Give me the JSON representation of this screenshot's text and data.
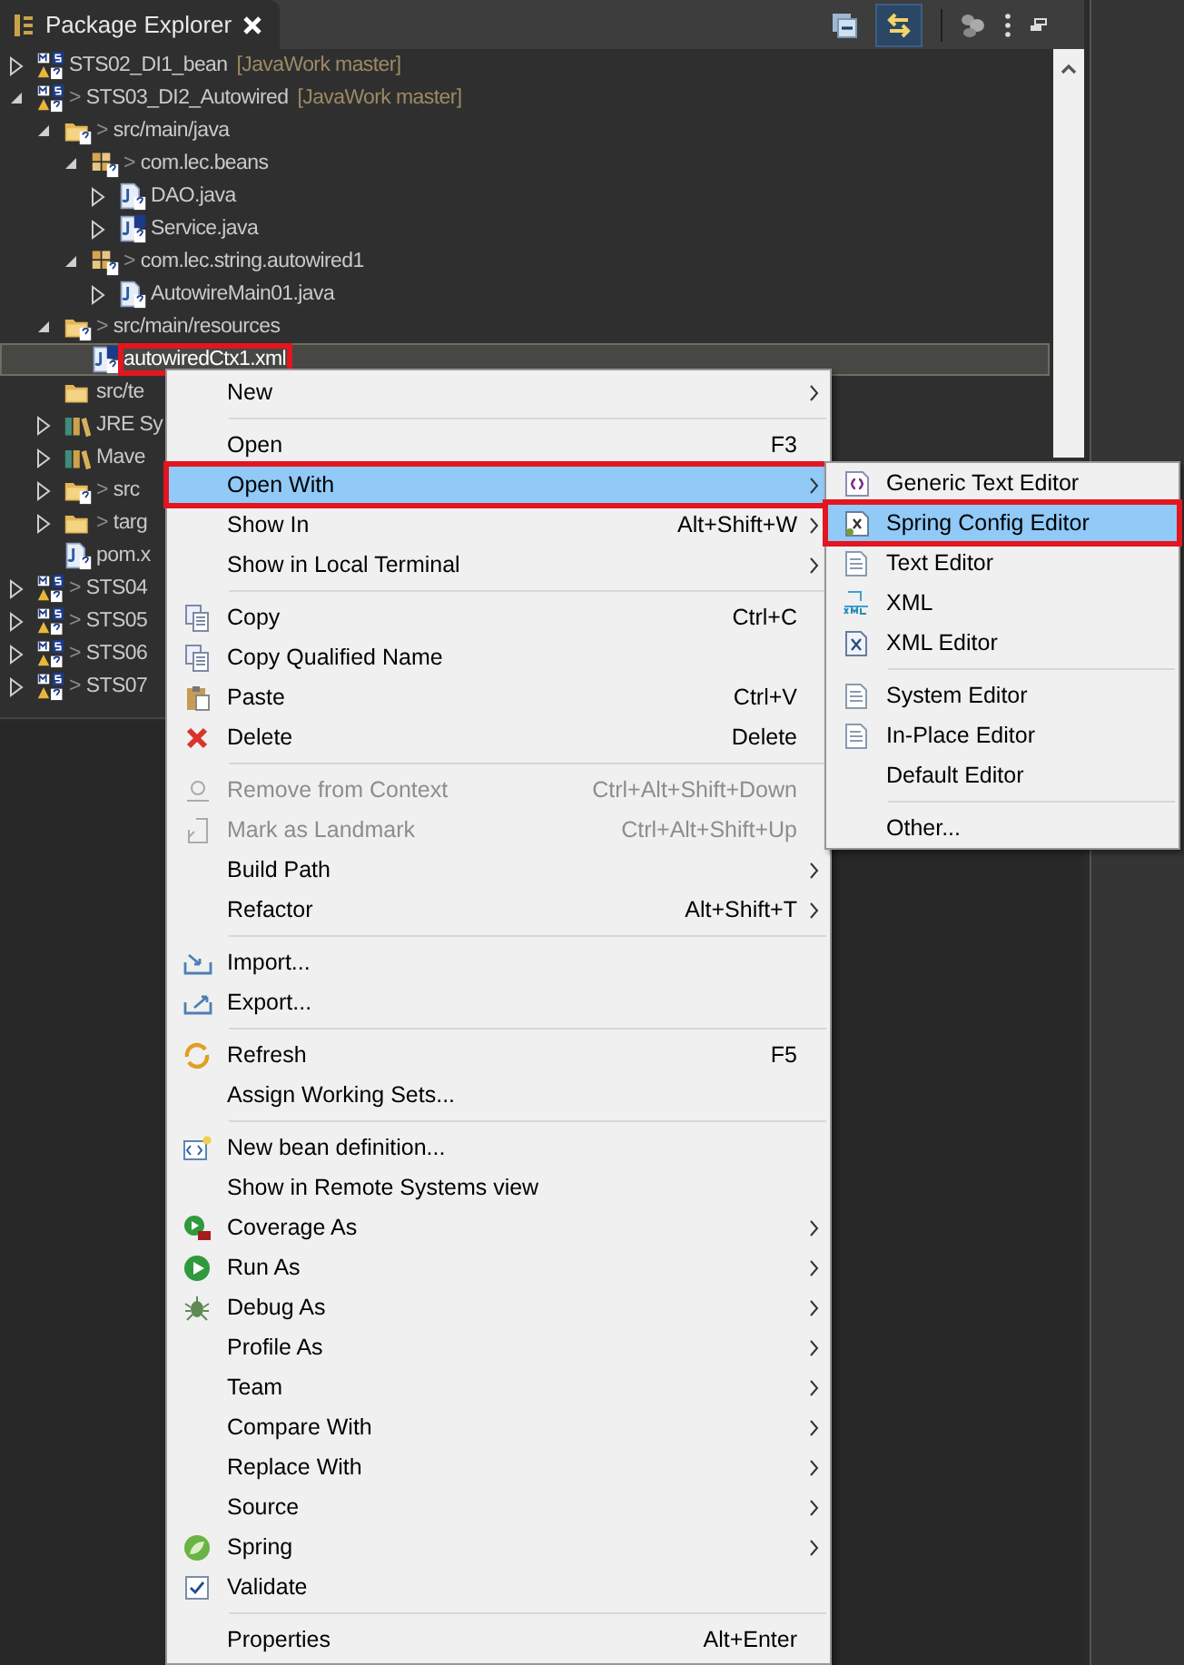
{
  "view_tab": {
    "title": "Package Explorer"
  },
  "tree": [
    {
      "label": "STS02_DI1_bean",
      "decoration": "[JavaWork master]",
      "kind": "project",
      "expanded": false,
      "selected": false
    },
    {
      "label": "STS03_DI2_Autowired",
      "marker": ">",
      "decoration": "[JavaWork master]",
      "kind": "project",
      "expanded": true,
      "selected": false,
      "children": [
        {
          "label": "src/main/java",
          "marker": ">",
          "kind": "source-folder",
          "expanded": true,
          "selected": false,
          "children": [
            {
              "label": "com.lec.beans",
              "marker": ">",
              "kind": "package",
              "expanded": true,
              "selected": false,
              "children": [
                {
                  "label": "DAO.java",
                  "kind": "java",
                  "expanded": false,
                  "selected": false
                },
                {
                  "label": "Service.java",
                  "kind": "interface",
                  "expanded": false,
                  "selected": false
                }
              ]
            },
            {
              "label": "com.lec.string.autowired1",
              "marker": ">",
              "kind": "package",
              "expanded": true,
              "selected": false,
              "children": [
                {
                  "label": "AutowireMain01.java",
                  "kind": "java",
                  "expanded": false,
                  "selected": false
                }
              ]
            }
          ]
        },
        {
          "label": "src/main/resources",
          "marker": ">",
          "kind": "source-folder",
          "expanded": true,
          "selected": false,
          "children": [
            {
              "label": "autowiredCtx1.xml",
              "kind": "xml",
              "selected": true,
              "highlighted": true
            }
          ]
        },
        {
          "label": "src/te",
          "kind": "folder",
          "selected": false
        },
        {
          "label": "JRE Sy",
          "kind": "library",
          "expanded": false,
          "selected": false
        },
        {
          "label": "Mave",
          "kind": "library",
          "expanded": false,
          "selected": false
        },
        {
          "label": "src",
          "marker": ">",
          "kind": "source-folder",
          "expanded": false,
          "selected": false
        },
        {
          "label": "targ",
          "marker": ">",
          "kind": "folder",
          "expanded": false,
          "selected": false
        },
        {
          "label": "pom.x",
          "kind": "pom",
          "selected": false
        }
      ]
    },
    {
      "label": "STS04",
      "marker": ">",
      "kind": "project",
      "expanded": false,
      "selected": false
    },
    {
      "label": "STS05",
      "marker": ">",
      "kind": "project",
      "expanded": false,
      "selected": false
    },
    {
      "label": "STS06",
      "marker": ">",
      "kind": "project",
      "expanded": false,
      "selected": false
    },
    {
      "label": "STS07",
      "marker": ">",
      "kind": "project",
      "expanded": false,
      "selected": false
    }
  ],
  "context_menu": [
    {
      "kind": "item",
      "label": "New",
      "submenu": true,
      "disabled": false,
      "selected": false
    },
    {
      "kind": "separator"
    },
    {
      "kind": "item",
      "label": "Open",
      "shortcut": "F3",
      "submenu": false,
      "disabled": false,
      "selected": false
    },
    {
      "kind": "item",
      "label": "Open With",
      "submenu": true,
      "disabled": false,
      "selected": true,
      "highlighted": true
    },
    {
      "kind": "item",
      "label": "Show In",
      "shortcut": "Alt+Shift+W",
      "submenu": true,
      "disabled": false,
      "selected": false
    },
    {
      "kind": "item",
      "label": "Show in Local Terminal",
      "submenu": true,
      "disabled": false,
      "selected": false
    },
    {
      "kind": "separator"
    },
    {
      "kind": "item",
      "label": "Copy",
      "shortcut": "Ctrl+C",
      "submenu": false,
      "disabled": false,
      "selected": false
    },
    {
      "kind": "item",
      "label": "Copy Qualified Name",
      "submenu": false,
      "disabled": false,
      "selected": false
    },
    {
      "kind": "item",
      "label": "Paste",
      "shortcut": "Ctrl+V",
      "submenu": false,
      "disabled": false,
      "selected": false
    },
    {
      "kind": "item",
      "label": "Delete",
      "shortcut": "Delete",
      "submenu": false,
      "disabled": false,
      "selected": false
    },
    {
      "kind": "separator"
    },
    {
      "kind": "item",
      "label": "Remove from Context",
      "shortcut": "Ctrl+Alt+Shift+Down",
      "submenu": false,
      "disabled": true,
      "selected": false
    },
    {
      "kind": "item",
      "label": "Mark as Landmark",
      "shortcut": "Ctrl+Alt+Shift+Up",
      "submenu": false,
      "disabled": true,
      "selected": false
    },
    {
      "kind": "item",
      "label": "Build Path",
      "submenu": true,
      "disabled": false,
      "selected": false
    },
    {
      "kind": "item",
      "label": "Refactor",
      "shortcut": "Alt+Shift+T",
      "submenu": true,
      "disabled": false,
      "selected": false
    },
    {
      "kind": "separator"
    },
    {
      "kind": "item",
      "label": "Import...",
      "submenu": false,
      "disabled": false,
      "selected": false
    },
    {
      "kind": "item",
      "label": "Export...",
      "submenu": false,
      "disabled": false,
      "selected": false
    },
    {
      "kind": "separator"
    },
    {
      "kind": "item",
      "label": "Refresh",
      "shortcut": "F5",
      "submenu": false,
      "disabled": false,
      "selected": false
    },
    {
      "kind": "item",
      "label": "Assign Working Sets...",
      "submenu": false,
      "disabled": false,
      "selected": false
    },
    {
      "kind": "separator"
    },
    {
      "kind": "item",
      "label": "New bean definition...",
      "submenu": false,
      "disabled": false,
      "selected": false
    },
    {
      "kind": "item",
      "label": "Show in Remote Systems view",
      "submenu": false,
      "disabled": false,
      "selected": false
    },
    {
      "kind": "item",
      "label": "Coverage As",
      "submenu": true,
      "disabled": false,
      "selected": false
    },
    {
      "kind": "item",
      "label": "Run As",
      "submenu": true,
      "disabled": false,
      "selected": false
    },
    {
      "kind": "item",
      "label": "Debug As",
      "submenu": true,
      "disabled": false,
      "selected": false
    },
    {
      "kind": "item",
      "label": "Profile As",
      "submenu": true,
      "disabled": false,
      "selected": false
    },
    {
      "kind": "item",
      "label": "Team",
      "submenu": true,
      "disabled": false,
      "selected": false
    },
    {
      "kind": "item",
      "label": "Compare With",
      "submenu": true,
      "disabled": false,
      "selected": false
    },
    {
      "kind": "item",
      "label": "Replace With",
      "submenu": true,
      "disabled": false,
      "selected": false
    },
    {
      "kind": "item",
      "label": "Source",
      "submenu": true,
      "disabled": false,
      "selected": false
    },
    {
      "kind": "item",
      "label": "Spring",
      "submenu": true,
      "disabled": false,
      "selected": false
    },
    {
      "kind": "item",
      "label": "Validate",
      "submenu": false,
      "disabled": false,
      "selected": false
    },
    {
      "kind": "separator"
    },
    {
      "kind": "item",
      "label": "Properties",
      "shortcut": "Alt+Enter",
      "submenu": false,
      "disabled": false,
      "selected": false
    }
  ],
  "open_with_submenu": [
    {
      "kind": "item",
      "label": "Generic Text Editor",
      "selected": false
    },
    {
      "kind": "item",
      "label": "Spring Config Editor",
      "selected": true,
      "highlighted": true
    },
    {
      "kind": "item",
      "label": "Text Editor",
      "selected": false
    },
    {
      "kind": "item",
      "label": "XML",
      "selected": false
    },
    {
      "kind": "item",
      "label": "XML Editor",
      "selected": false
    },
    {
      "kind": "separator"
    },
    {
      "kind": "item",
      "label": "System Editor",
      "selected": false
    },
    {
      "kind": "item",
      "label": "In-Place Editor",
      "selected": false
    },
    {
      "kind": "item",
      "label": "Default Editor",
      "selected": false
    },
    {
      "kind": "separator"
    },
    {
      "kind": "item",
      "label": "Other...",
      "selected": false
    }
  ]
}
